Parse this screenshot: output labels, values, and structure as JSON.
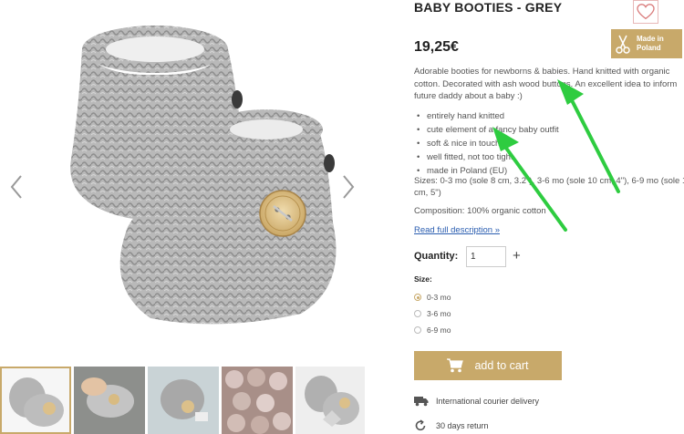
{
  "product": {
    "title": "BABY BOOTIES - GREY",
    "price": "19,25€",
    "badge": {
      "line1": "Made in",
      "line2": "Poland",
      "icon": "scissors-icon"
    },
    "description": "Adorable booties for newborns & babies. Hand knitted with organic cotton. Decorated with ash wood buttons. An excellent idea to inform future daddy about a baby :)",
    "features": [
      "entirely hand knitted",
      "cute element of a fancy baby outfit",
      "soft & nice in touch",
      "well fitted, not too tight",
      "made in Poland (EU)"
    ],
    "sizes_text": "Sizes: 0-3 mo (sole 8 cm, 3.2\"), 3-6 mo (sole 10 cm, 4\"), 6-9 mo (sole 12 cm, 5\")",
    "composition": "Composition: 100% organic cotton",
    "read_more": "Read full description »"
  },
  "purchase": {
    "quantity_label": "Quantity:",
    "quantity_value": "1",
    "plus_label": "+",
    "size_label": "Size:",
    "size_options": [
      "0-3 mo",
      "3-6 mo",
      "6-9 mo"
    ],
    "selected_size": "0-3 mo",
    "add_to_cart": "add to cart"
  },
  "shipping": {
    "delivery": "International courier delivery",
    "returns": "30 days return"
  },
  "gallery": {
    "thumbnail_count": 5,
    "active_thumbnail": 1
  },
  "colors": {
    "accent": "#c8a96a",
    "link": "#2a5db0",
    "annotation_arrow": "#2ecc40",
    "wool": "#a9a9a9"
  }
}
